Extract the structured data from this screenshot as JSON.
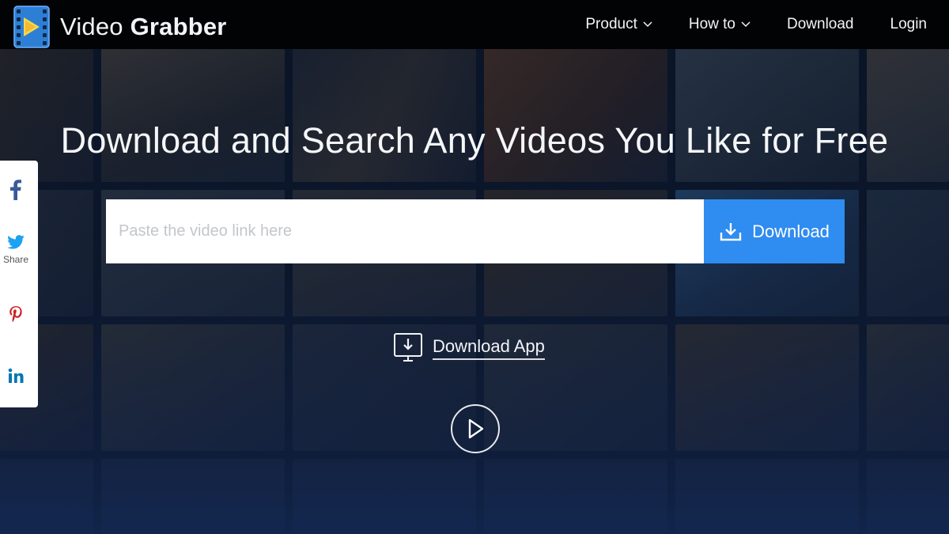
{
  "app": {
    "name_light": "Video",
    "name_bold": "Grabber"
  },
  "nav": {
    "items": [
      {
        "label": "Product",
        "has_dropdown": true
      },
      {
        "label": "How to",
        "has_dropdown": true
      },
      {
        "label": "Download",
        "has_dropdown": false
      },
      {
        "label": "Login",
        "has_dropdown": false
      }
    ]
  },
  "hero": {
    "title": "Download and Search Any Videos You Like for Free",
    "search_placeholder": "Paste the video link here",
    "search_value": "",
    "download_button_label": "Download",
    "download_app_label": "Download App"
  },
  "share": {
    "label": "Share",
    "items": [
      "facebook-icon",
      "twitter-icon",
      "pinterest-icon",
      "linkedin-icon"
    ]
  },
  "colors": {
    "header_bg": "#020305",
    "accent_blue": "#2f8cf0",
    "facebook": "#3b5998",
    "twitter": "#1da1f2",
    "pinterest": "#cb2027",
    "linkedin": "#0077b5"
  },
  "icons": {
    "logo": "film-strip-play-icon",
    "download_button": "download-tray-icon",
    "download_app": "monitor-download-icon",
    "play": "play-circle-icon",
    "nav_dropdown": "chevron-down-icon"
  }
}
